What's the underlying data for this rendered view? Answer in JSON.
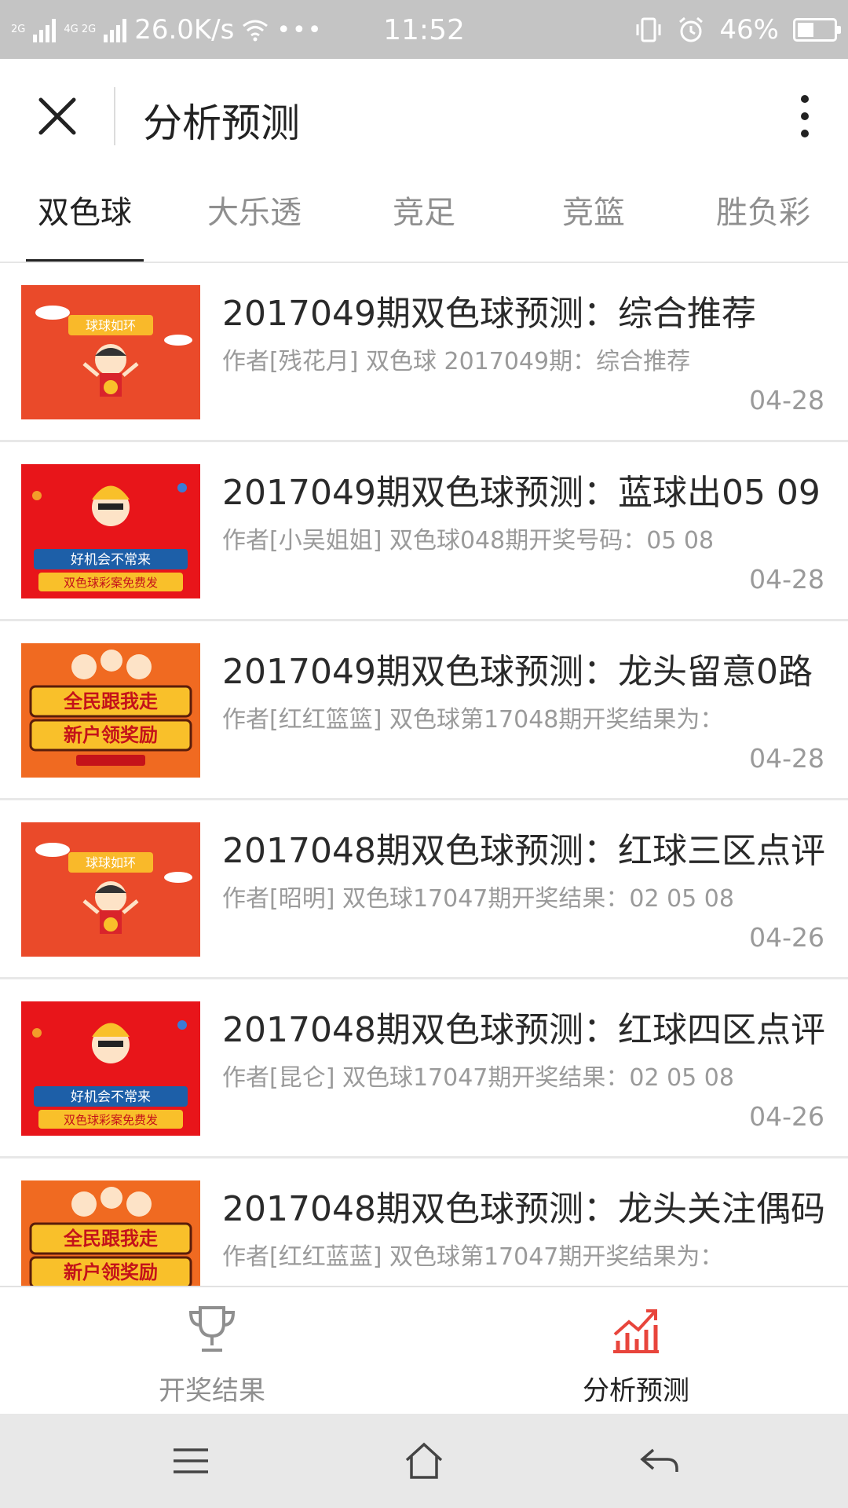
{
  "status_bar": {
    "network_top": "2G",
    "network_bottom": "4G 2G",
    "speed": "26.0K/s",
    "dots": "•••",
    "time": "11:52",
    "battery": "46%",
    "battery_level": 0.46
  },
  "header": {
    "title": "分析预测"
  },
  "tabs": [
    {
      "label": "双色球",
      "active": true
    },
    {
      "label": "大乐透",
      "active": false
    },
    {
      "label": "竞足",
      "active": false
    },
    {
      "label": "竞篮",
      "active": false
    },
    {
      "label": "胜负彩",
      "active": false
    }
  ],
  "articles": [
    {
      "title": "2017049期双色球预测：综合推荐",
      "desc": "作者[残花月] 双色球 2017049期：综合推荐",
      "date": "04-28",
      "thumb_text": "球球如环"
    },
    {
      "title": "2017049期双色球预测：蓝球出05 09",
      "desc": "作者[小吴姐姐] 双色球048期开奖号码：05 08",
      "date": "04-28",
      "thumb_text": "好机会不常来",
      "thumb_text2": "双色球彩案免费发"
    },
    {
      "title": "2017049期双色球预测：龙头留意0路",
      "desc": "作者[红红篮篮] 双色球第17048期开奖结果为：",
      "date": "04-28",
      "thumb_text": "全民跟我走",
      "thumb_text2": "新户领奖励"
    },
    {
      "title": "2017048期双色球预测：红球三区点评",
      "desc": "作者[昭明] 双色球17047期开奖结果：02 05 08",
      "date": "04-26",
      "thumb_text": "球球如环"
    },
    {
      "title": "2017048期双色球预测：红球四区点评",
      "desc": "作者[昆仑] 双色球17047期开奖结果：02 05 08",
      "date": "04-26",
      "thumb_text": "好机会不常来",
      "thumb_text2": "双色球彩案免费发"
    },
    {
      "title": "2017048期双色球预测：龙头关注偶码",
      "desc": "作者[红红蓝蓝] 双色球第17047期开奖结果为：",
      "date": "",
      "thumb_text": "全民跟我走",
      "thumb_text2": "新户领奖励"
    }
  ],
  "bottom_tabs": [
    {
      "label": "开奖结果",
      "icon": "trophy-icon",
      "active": false
    },
    {
      "label": "分析预测",
      "icon": "trend-chart-icon",
      "active": true
    }
  ],
  "nav_bar": {
    "menu_icon": "menu-icon",
    "home_icon": "home-icon",
    "back_icon": "back-icon"
  },
  "colors": {
    "accent": "#e8453c",
    "status_bar": "#c4c4c4",
    "thumb_orange": "#ea4a2a",
    "thumb_red": "#e8151a",
    "thumb_orange2": "#f06a21"
  }
}
